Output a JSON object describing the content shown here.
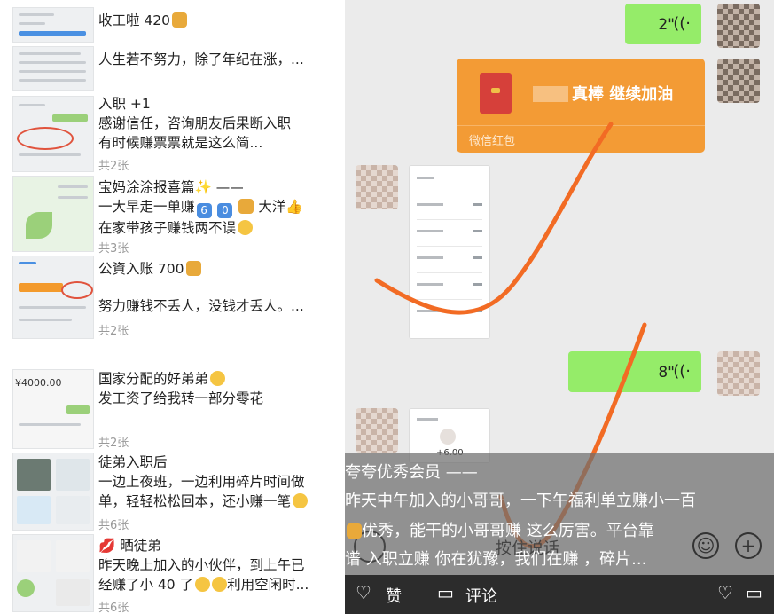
{
  "feed": {
    "posts": [
      {
        "lines": [
          "收工啦 420"
        ],
        "count": ""
      },
      {
        "lines": [
          "人生若不努力，除了年纪在涨，..."
        ],
        "count": ""
      },
      {
        "lines": [
          "入职 +1",
          "感谢信任，咨询朋友后果断入职",
          "有时候赚票票就是这么简..."
        ],
        "count": "共2张"
      },
      {
        "lines": [
          "宝妈涂涂报喜篇",
          "一大早走一单赚",
          "在家带孩子赚钱两不误"
        ],
        "count": "共3张"
      },
      {
        "lines": [
          "公資入账 700"
        ],
        "count": ""
      },
      {
        "lines": [
          "努力赚钱不丢人，没钱才丢人。..."
        ],
        "count": "共2张"
      },
      {
        "lines": [
          "国家分配的好弟弟",
          "发工资了给我转一部分零花"
        ],
        "count": "共2张"
      },
      {
        "lines": [
          "徒弟入职后",
          "一边上夜班，一边利用碎片时间做",
          "单，轻轻松松回本，还小赚一笔"
        ],
        "count": "共6张"
      },
      {
        "lines": [
          "晒徒弟",
          "昨天晚上加入的小伙伴，到上午已",
          "经赚了小 40 了",
          "利用空闲时..."
        ],
        "count": "共6张"
      }
    ],
    "extras": {
      "dash": " ——",
      "six": "6",
      "zero": "0",
      "big_ocean": "大洋",
      "thumb_amount": "¥4000.00"
    }
  },
  "chat": {
    "voice1": {
      "duration": "2\"",
      "wave": "((·"
    },
    "voice2": {
      "duration": "8\"",
      "wave": "((·"
    },
    "red_packet": {
      "message": "真棒  继续加油",
      "footer": "微信红包"
    },
    "shot_amount": "+6.00"
  },
  "overlay": {
    "lines": [
      "夸夸优秀会员 ——",
      "昨天中午加入的小哥哥，一下午福利单立赚小一百",
      "优秀，能干的小哥哥赚 这么厉害。平台靠",
      "谱 入职立赚 你在犹豫，我们在赚 ，碎片..."
    ],
    "hidden_text": "按住说话"
  },
  "bottom_bar": {
    "like_label": "赞",
    "comment_label": "评论"
  },
  "colors": {
    "voice_green": "#95ec69",
    "red_packet_orange": "#f39b35",
    "annotation_orange": "#f26b24"
  }
}
